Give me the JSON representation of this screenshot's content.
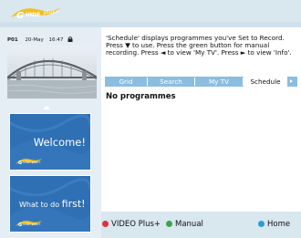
{
  "header": {
    "logo_text": "GUIDE Plus+"
  },
  "channel_info": {
    "channel": "P01",
    "date": "20-May",
    "time": "16:47",
    "lock_icon": "lock-icon"
  },
  "promo_cards": {
    "welcome": "Welcome!",
    "what_to_do_prefix": "What to do ",
    "what_to_do_emph": "first!"
  },
  "description": "'Schedule' displays programmes you've Set to Record. Press ▼ to use.  Press the green button for manual recording. Press ◄ to view 'My TV'.  Press ► to view 'Info'.",
  "tabs": [
    {
      "label": "Grid",
      "active": false
    },
    {
      "label": "Search",
      "active": false
    },
    {
      "label": "My TV",
      "active": false
    },
    {
      "label": "Schedule",
      "active": true
    }
  ],
  "content": {
    "empty_message": "No programmes"
  },
  "footer": {
    "vplus_label": "VIDEO Plus+",
    "manual_label": "Manual",
    "home_label": "Home"
  },
  "colors": {
    "red": "#d8343f",
    "green": "#3fa34d",
    "blue": "#2e9bd6",
    "tab_bar": "#8bbde0",
    "card_bg": "#2f6fb3",
    "logo_yellow": "#f2c01a"
  }
}
